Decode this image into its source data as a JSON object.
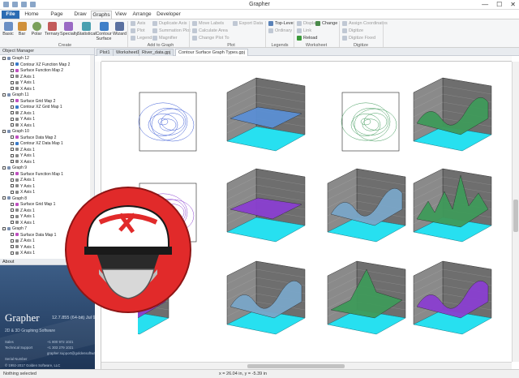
{
  "window": {
    "title": "Grapher",
    "controls": [
      "—",
      "☐",
      "✕"
    ]
  },
  "menu_tabs": [
    {
      "label": "File"
    },
    {
      "label": "Home"
    },
    {
      "label": "Page Layout"
    },
    {
      "label": "Draw"
    },
    {
      "label": "Graphs"
    },
    {
      "label": "View"
    },
    {
      "label": "Arrange"
    },
    {
      "label": "Developer"
    }
  ],
  "ribbon": {
    "create": {
      "label": "Create",
      "buttons": [
        "Basic",
        "Bar",
        "Polar",
        "Ternary",
        "Specialty",
        "Statistical",
        "Contour Surface",
        "Wizard"
      ]
    },
    "add_to_graph": {
      "label": "Add to Graph",
      "col1": [
        "Axis",
        "Plot",
        "Legend"
      ],
      "col2": [
        "Duplicate Axis",
        "Summation Plot",
        "Magnifier"
      ]
    },
    "plot": {
      "label": "Plot",
      "items": [
        "Move Labels",
        "Calculate Area",
        "Change Plot To"
      ]
    },
    "export_data": "Export Data",
    "legends": {
      "label": "Legends",
      "items": [
        "Top-Level",
        "Ordinary"
      ]
    },
    "worksheet": {
      "label": "Worksheet",
      "items": [
        "Display",
        "Change",
        "Link",
        "Reload"
      ]
    },
    "digitize": {
      "label": "Digitize",
      "items": [
        "Assign Coordinates",
        "Digitize",
        "Digitize Fixed"
      ]
    }
  },
  "document_tabs": [
    {
      "label": "Plot1"
    },
    {
      "label": "Worksheet1"
    },
    {
      "label": "River_data.gpj"
    },
    {
      "label": "Contour Surface Graph Types.gpj"
    }
  ],
  "object_manager": {
    "title": "Object Manager",
    "rows": [
      {
        "text": "Graph 12",
        "indent": 0,
        "type": "graph"
      },
      {
        "text": "Contour XZ Function Map 2",
        "indent": 1,
        "type": "contour"
      },
      {
        "text": "Surface Function Map 2",
        "indent": 1,
        "type": "surface"
      },
      {
        "text": "Z Axis 1",
        "indent": 1,
        "type": "axis"
      },
      {
        "text": "Y Axis 1",
        "indent": 1,
        "type": "axis"
      },
      {
        "text": "X Axis 1",
        "indent": 1,
        "type": "axis"
      },
      {
        "text": "Graph 11",
        "indent": 0,
        "type": "graph"
      },
      {
        "text": "Surface Grid Map 2",
        "indent": 1,
        "type": "surface"
      },
      {
        "text": "Contour XZ Grid Map 1",
        "indent": 1,
        "type": "contour"
      },
      {
        "text": "Z Axis 1",
        "indent": 1,
        "type": "axis"
      },
      {
        "text": "Y Axis 1",
        "indent": 1,
        "type": "axis"
      },
      {
        "text": "X Axis 1",
        "indent": 1,
        "type": "axis"
      },
      {
        "text": "Graph 10",
        "indent": 0,
        "type": "graph"
      },
      {
        "text": "Surface Data Map 2",
        "indent": 1,
        "type": "surface"
      },
      {
        "text": "Contour XZ Data Map 1",
        "indent": 1,
        "type": "contour"
      },
      {
        "text": "Z Axis 1",
        "indent": 1,
        "type": "axis"
      },
      {
        "text": "Y Axis 1",
        "indent": 1,
        "type": "axis"
      },
      {
        "text": "X Axis 1",
        "indent": 1,
        "type": "axis"
      },
      {
        "text": "Graph 9",
        "indent": 0,
        "type": "graph"
      },
      {
        "text": "Surface Function Map 1",
        "indent": 1,
        "type": "surface"
      },
      {
        "text": "Z Axis 1",
        "indent": 1,
        "type": "axis"
      },
      {
        "text": "Y Axis 1",
        "indent": 1,
        "type": "axis"
      },
      {
        "text": "X Axis 1",
        "indent": 1,
        "type": "axis"
      },
      {
        "text": "Graph 8",
        "indent": 0,
        "type": "graph"
      },
      {
        "text": "Surface Grid Map 1",
        "indent": 1,
        "type": "surface"
      },
      {
        "text": "Z Axis 1",
        "indent": 1,
        "type": "axis"
      },
      {
        "text": "Y Axis 1",
        "indent": 1,
        "type": "axis"
      },
      {
        "text": "X Axis 1",
        "indent": 1,
        "type": "axis"
      },
      {
        "text": "Graph 7",
        "indent": 0,
        "type": "graph"
      },
      {
        "text": "Surface Data Map 1",
        "indent": 1,
        "type": "surface"
      },
      {
        "text": "Z Axis 1",
        "indent": 1,
        "type": "axis"
      },
      {
        "text": "Y Axis 1",
        "indent": 1,
        "type": "axis"
      },
      {
        "text": "X Axis 1",
        "indent": 1,
        "type": "axis"
      }
    ]
  },
  "about": {
    "title": "About",
    "product": "Grapher",
    "version": "12.7.855 (64-bit) Jul 9 2017",
    "subtitle": "2D & 3D Graphing Software",
    "sales_label": "Sales",
    "support_label": "Technical Support",
    "serial_label": "Serial Number",
    "sales_phone": "+1 800 972 1021",
    "support_phone": "+1 303 279 1021",
    "email": "grapher.support@goldensoftware.com",
    "company": "Golden Software, LLC",
    "address1": "809 14th Street",
    "address2": "Golden, Colorado 80401-1866",
    "web": "www.goldensoftware.com",
    "copyright": "© 1992-2017 Golden Software, LLC"
  },
  "status_bar": {
    "left": "Nothing selected",
    "coords": "x = 26.04 in, y = -5.39 in"
  },
  "colors": {
    "file_tab": "#2b6cb3",
    "surface_blue": "#5b8fd4",
    "surface_green": "#3f9a5a",
    "surface_purple": "#8a3fd0",
    "floor": "#27e0f0",
    "wall": "#6e6e6e",
    "logo_red": "#e12a2a"
  }
}
